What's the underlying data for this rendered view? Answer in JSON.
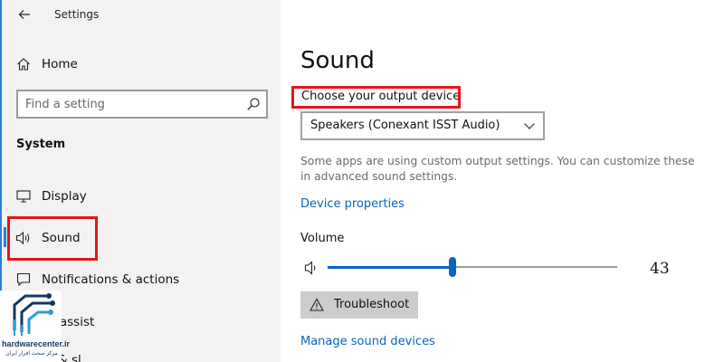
{
  "window": {
    "title": "Settings"
  },
  "sidebar": {
    "home_label": "Home",
    "search": {
      "placeholder": "Find a setting",
      "value": ""
    },
    "section_title": "System",
    "items": [
      {
        "label": "Display",
        "icon": "display-icon"
      },
      {
        "label": "Sound",
        "icon": "speaker-icon",
        "selected": true
      },
      {
        "label": "Notifications & actions",
        "icon": "notifications-icon"
      },
      {
        "label": "us assist",
        "icon": "focus-assist-icon"
      },
      {
        "label": "er & sl",
        "icon": "power-icon"
      }
    ]
  },
  "main": {
    "title": "Sound",
    "output_label": "Choose your output device",
    "output_device": {
      "selected": "Speakers (Conexant ISST Audio)"
    },
    "info_text": "Some apps are using custom output settings. You can customize these in advanced sound settings.",
    "device_properties_link": "Device properties",
    "volume_label": "Volume",
    "volume_value": "43",
    "volume_level": 43,
    "troubleshoot_label": "Troubleshoot",
    "manage_link": "Manage sound devices"
  },
  "watermark": {
    "name": "hardwarecenter.ir",
    "subtitle": "مرکز سخت افزار ایران"
  },
  "colors": {
    "accent": "#0a64c2",
    "highlight_box": "#e3141e",
    "sidebar_bg": "#f2f2f2",
    "button_bg": "#cccccc"
  }
}
